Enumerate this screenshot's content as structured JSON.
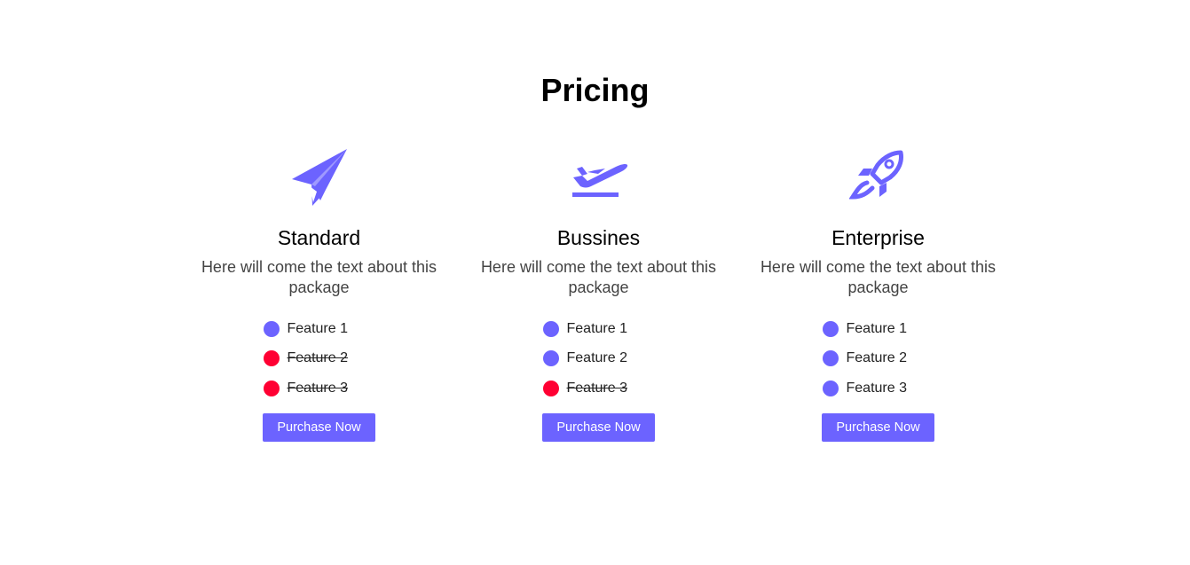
{
  "page": {
    "title": "Pricing"
  },
  "colors": {
    "accent": "#6c63ff",
    "excluded": "#ff0033"
  },
  "plans": [
    {
      "name": "Standard",
      "icon": "paper-plane-icon",
      "description": "Here will come the text about this package",
      "features": [
        {
          "label": "Feature 1",
          "included": true
        },
        {
          "label": "Feature 2",
          "included": false
        },
        {
          "label": "Feature 3",
          "included": false
        }
      ],
      "button_label": "Purchase Now"
    },
    {
      "name": "Bussines",
      "icon": "airplane-takeoff-icon",
      "description": "Here will come the text about this package",
      "features": [
        {
          "label": "Feature 1",
          "included": true
        },
        {
          "label": "Feature 2",
          "included": true
        },
        {
          "label": "Feature 3",
          "included": false
        }
      ],
      "button_label": "Purchase Now"
    },
    {
      "name": "Enterprise",
      "icon": "rocket-icon",
      "description": "Here will come the text about this package",
      "features": [
        {
          "label": "Feature 1",
          "included": true
        },
        {
          "label": "Feature 2",
          "included": true
        },
        {
          "label": "Feature 3",
          "included": true
        }
      ],
      "button_label": "Purchase Now"
    }
  ]
}
